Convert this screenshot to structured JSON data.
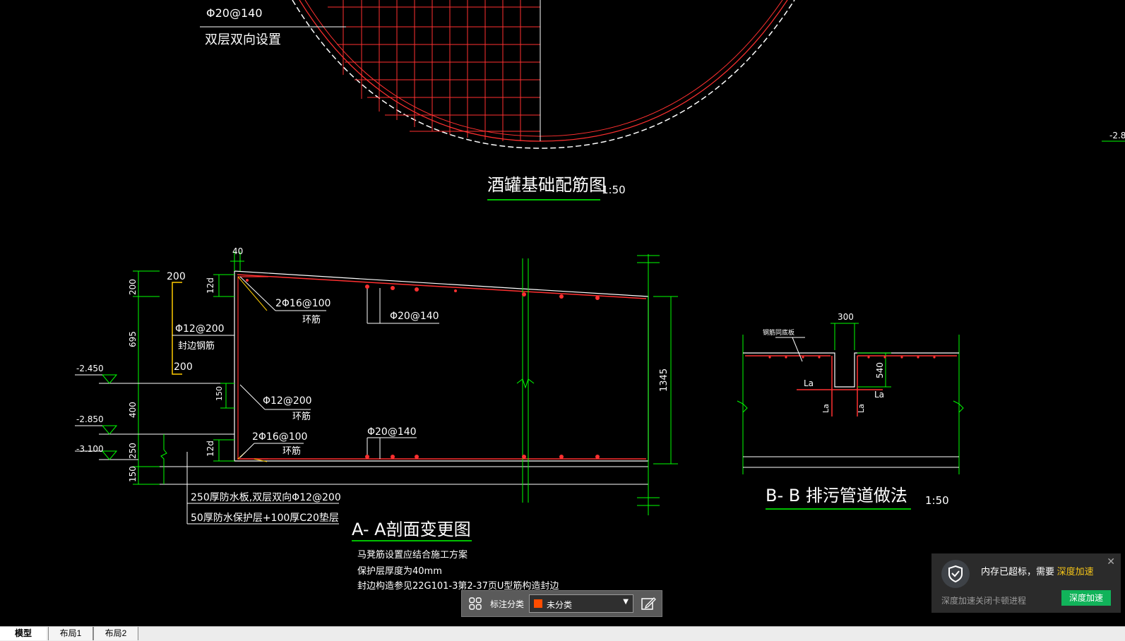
{
  "drawing": {
    "top_rebar_label": "Φ20@140",
    "top_rebar_note": "双层双向设置",
    "plan_title": "酒罐基础配筋图",
    "plan_scale": "1:50",
    "edge_marker": "-2.8",
    "section_aa": {
      "dim_40": "40",
      "dim_200_top": "200",
      "dim_200_left": "200",
      "dim_695": "695",
      "dim_400": "400",
      "dim_250": "250",
      "dim_150": "150",
      "dim_150b": "150",
      "dim_12d_a": "12d",
      "dim_12d_b": "12d",
      "dim_1345": "1345",
      "elev_1": "-2.450",
      "elev_2": "-2.850",
      "elev_3": "-3.100",
      "rebar_2phi16_top": "2Φ16@100",
      "ring_top": "环筋",
      "rebar_phi20_top": "Φ20@140",
      "rebar_phi12_edge": "Φ12@200",
      "edge_rebar": "封边钢筋",
      "dim_200_bottom": "200",
      "rebar_phi12_ring": "Φ12@200",
      "ring_mid": "环筋",
      "rebar_2phi16_bot": "2Φ16@100",
      "ring_bot": "环筋",
      "rebar_phi20_bot": "Φ20@140",
      "layer_1": "250厚防水板,双层双向Φ12@200",
      "layer_2": "50厚防水保护层+100厚C20垫层",
      "title": "A- A剖面变更图",
      "note_1": "马凳筋设置应结合施工方案",
      "note_2": "保护层厚度为40mm",
      "note_3": "封边构造参见22G101-3第2-37页U型筋构造封边"
    },
    "section_bb": {
      "dim_300": "300",
      "dim_540": "540",
      "label_steel": "钢筋同底板",
      "la_1": "La",
      "la_2": "La",
      "la_3": "La",
      "la_4": "La",
      "title": "B- B  排污管道做法",
      "scale": "1:50"
    }
  },
  "annotation_bar": {
    "label": "标注分类",
    "selected": "未分类",
    "swatch_color": "#ff4d00"
  },
  "notification": {
    "message": "内存已超标，需要",
    "highlight": "深度加速",
    "sub": "深度加速关闭卡顿进程",
    "button": "深度加速",
    "close": "✕"
  },
  "tabs": [
    "模型",
    "布局1",
    "布局2"
  ]
}
